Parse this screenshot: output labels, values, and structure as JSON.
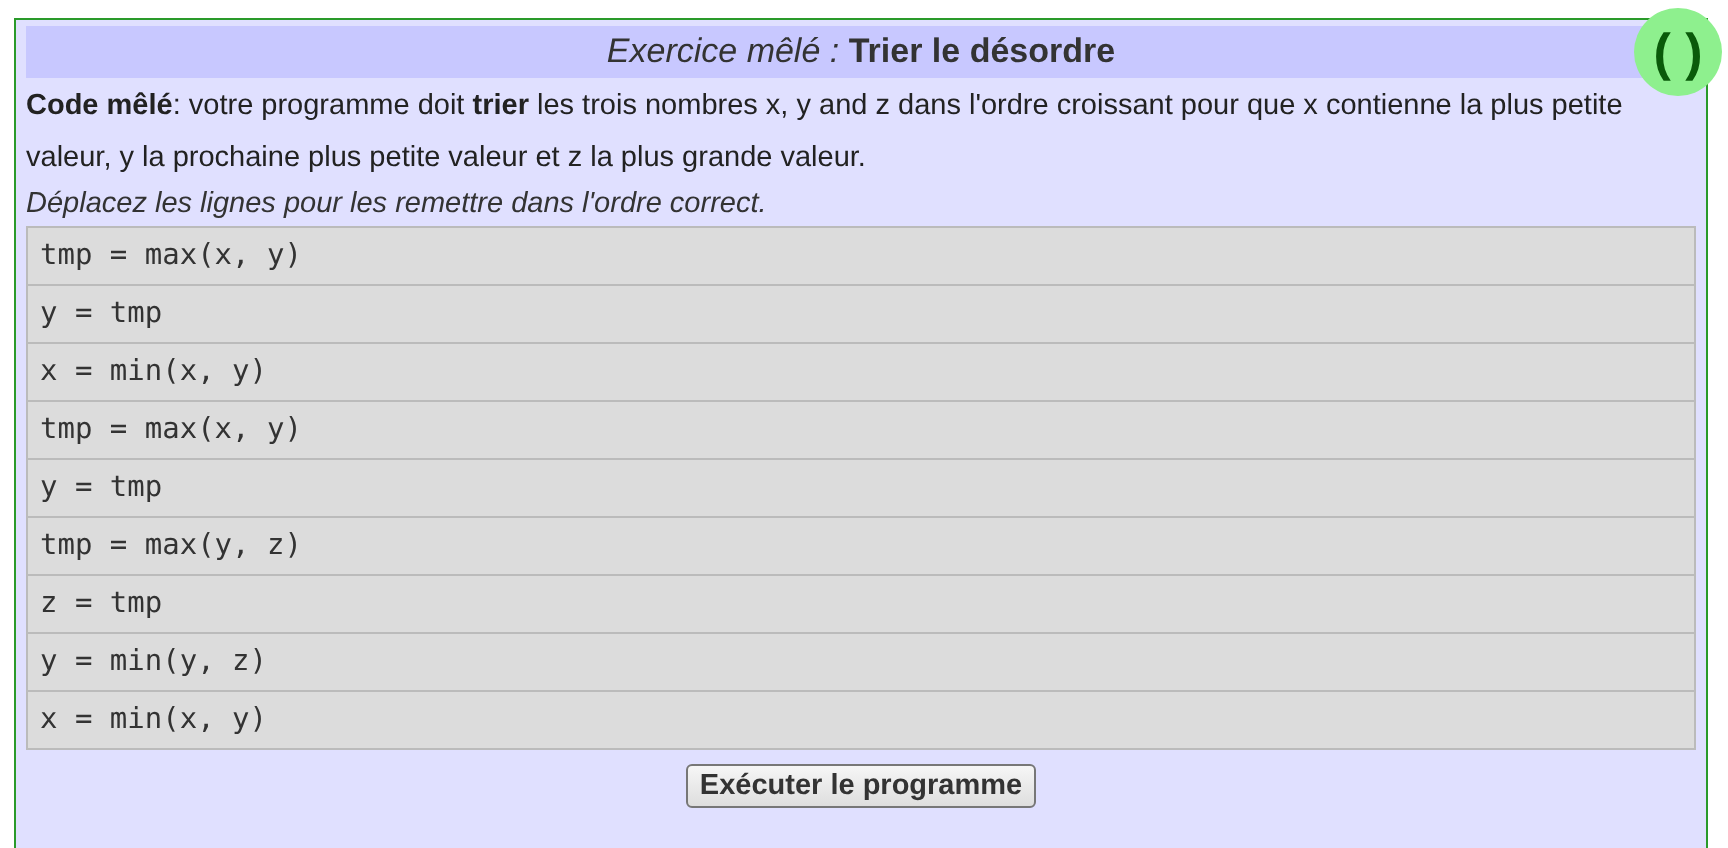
{
  "title": "*Exercice mêlé :* **Trier le désordre**",
  "badge": "( )",
  "description": "**Code mêlé**: votre programme doit **trier** les trois nombres x, y and z dans l'ordre croissant pour que x contienne la plus petite valeur, y la prochaine plus petite valeur et z la plus grande valeur.",
  "instructions": "Déplacez les lignes pour les remettre dans l'ordre correct.",
  "lines": [
    "tmp = max(x, y)",
    "y = tmp",
    "x = min(x, y)",
    "tmp = max(x, y)",
    "y = tmp",
    "tmp = max(y, z)",
    "z = tmp",
    "y = min(y, z)",
    "x = min(x, y)"
  ],
  "run_button": "Exécuter le programme"
}
